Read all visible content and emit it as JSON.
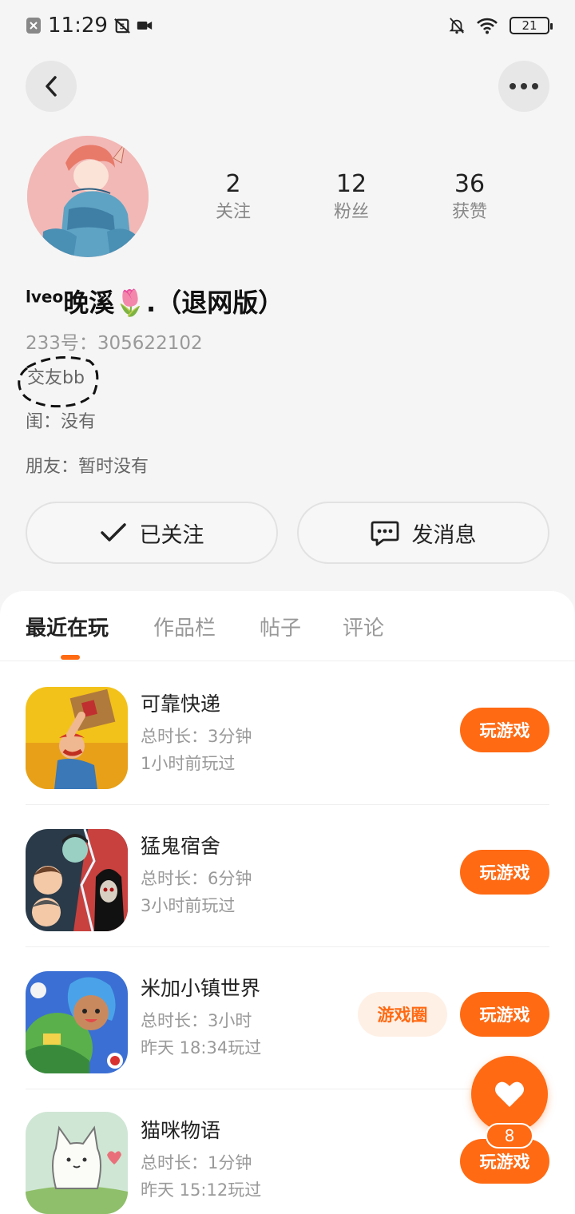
{
  "status_bar": {
    "time": "11:29",
    "battery": "21"
  },
  "profile": {
    "stats": [
      {
        "value": "2",
        "label": "关注"
      },
      {
        "value": "12",
        "label": "粉丝"
      },
      {
        "value": "36",
        "label": "获赞"
      }
    ],
    "username_prefix": "lveo",
    "username": "晚溪🌷.（退网版）",
    "id_line": "233号：305622102",
    "bio_lines": [
      "交友bb",
      "闺：没有",
      "朋友：暂时没有"
    ]
  },
  "actions": {
    "follow_label": "已关注",
    "message_label": "发消息"
  },
  "tabs": [
    {
      "label": "最近在玩",
      "active": true
    },
    {
      "label": "作品栏",
      "active": false
    },
    {
      "label": "帖子",
      "active": false
    },
    {
      "label": "评论",
      "active": false
    }
  ],
  "games": [
    {
      "title": "可靠快递",
      "duration": "总时长：3分钟",
      "last_played": "1小时前玩过",
      "play_label": "玩游戏",
      "icon": "reliable-delivery-icon"
    },
    {
      "title": "猛鬼宿舍",
      "duration": "总时长：6分钟",
      "last_played": "3小时前玩过",
      "play_label": "玩游戏",
      "icon": "ghost-dorm-icon"
    },
    {
      "title": "米加小镇世界",
      "duration": "总时长：3小时",
      "last_played": "昨天 18:34玩过",
      "play_label": "玩游戏",
      "circle_label": "游戏圈",
      "icon": "miga-town-icon"
    },
    {
      "title": "猫咪物语",
      "duration": "总时长：1分钟",
      "last_played": "昨天 15:12玩过",
      "play_label": "玩游戏",
      "icon": "cat-story-icon"
    }
  ],
  "fab": {
    "badge": "8"
  },
  "colors": {
    "accent": "#ff6a13",
    "accent_light": "#fff0e6"
  }
}
